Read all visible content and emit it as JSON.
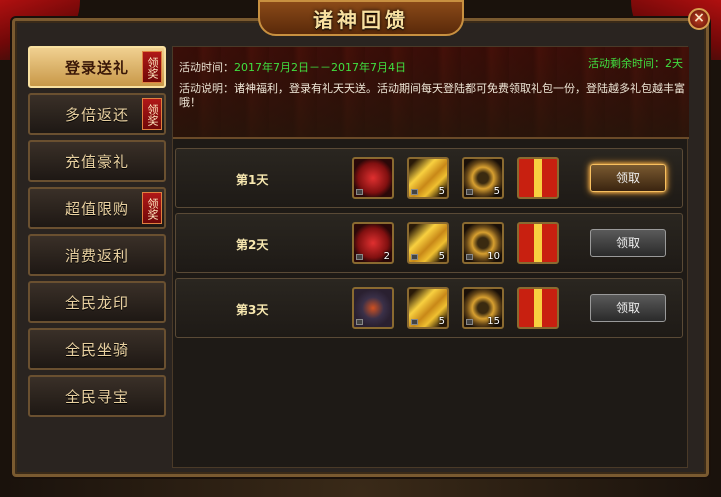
{
  "window": {
    "title": "诸神回馈",
    "close_label": "×"
  },
  "sidebar": {
    "items": [
      {
        "label": "登录送礼",
        "badge": "领奖",
        "active": true
      },
      {
        "label": "多倍返还",
        "badge": "领奖"
      },
      {
        "label": "充值豪礼",
        "badge": ""
      },
      {
        "label": "超值限购",
        "badge": "领奖"
      },
      {
        "label": "消费返利",
        "badge": ""
      },
      {
        "label": "全民龙印",
        "badge": ""
      },
      {
        "label": "全民坐骑",
        "badge": ""
      },
      {
        "label": "全民寻宝",
        "badge": ""
      }
    ]
  },
  "activity": {
    "time_label": "活动时间：",
    "time_value": "2017年7月2日－－2017年7月4日",
    "remaining_label": "活动剩余时间：",
    "remaining_value": "2天",
    "desc_label": "活动说明：",
    "desc_text": "诸神福利，登录有礼天天送。活动期间每天登陆都可免费领取礼包一份，登陆越多礼包越丰富哦！"
  },
  "rewards": [
    {
      "day": "第1天",
      "button": "领取",
      "items": [
        {
          "icon": "red-gem-icon",
          "count": ""
        },
        {
          "icon": "gold-ingot-icon",
          "count": "5"
        },
        {
          "icon": "gold-badge-icon",
          "count": "5"
        },
        {
          "icon": "gift-box-icon",
          "count": ""
        }
      ]
    },
    {
      "day": "第2天",
      "button": "领取",
      "items": [
        {
          "icon": "red-gem-icon",
          "count": "2"
        },
        {
          "icon": "gold-ingot-icon",
          "count": "5"
        },
        {
          "icon": "gold-badge-icon",
          "count": "10"
        },
        {
          "icon": "gift-box-icon",
          "count": ""
        }
      ]
    },
    {
      "day": "第3天",
      "button": "领取",
      "items": [
        {
          "icon": "skill-scroll-icon",
          "count": ""
        },
        {
          "icon": "gold-ingot-icon",
          "count": "5"
        },
        {
          "icon": "gold-badge-icon",
          "count": "15"
        },
        {
          "icon": "gift-box-icon",
          "count": ""
        }
      ]
    }
  ],
  "colors": {
    "accent_gold": "#c89040",
    "highlight_green": "#40e040",
    "badge_red": "#b01818"
  }
}
